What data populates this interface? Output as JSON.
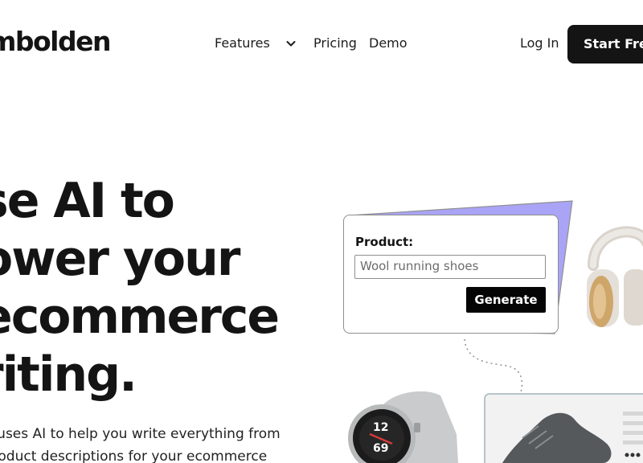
{
  "header": {
    "logo": "mbolden",
    "nav": {
      "features": "Features",
      "pricing": "Pricing",
      "demo": "Demo"
    },
    "login": "Log In",
    "cta": "Start Free"
  },
  "hero": {
    "headline_lines": [
      "se AI to",
      "ower your",
      "ecommerce",
      "riting."
    ],
    "subtext_lines": [
      "n uses AI to help you write everything from",
      "product descriptions for your ecommerce"
    ]
  },
  "demo_card": {
    "label": "Product:",
    "input_value": "Wool running shoes",
    "button": "Generate"
  },
  "colors": {
    "accent_purple": "#a9a4f5",
    "ink": "#141414"
  },
  "icons": [
    "chevron-down-icon",
    "headphones-image",
    "smartwatch-image",
    "sneaker-image"
  ]
}
